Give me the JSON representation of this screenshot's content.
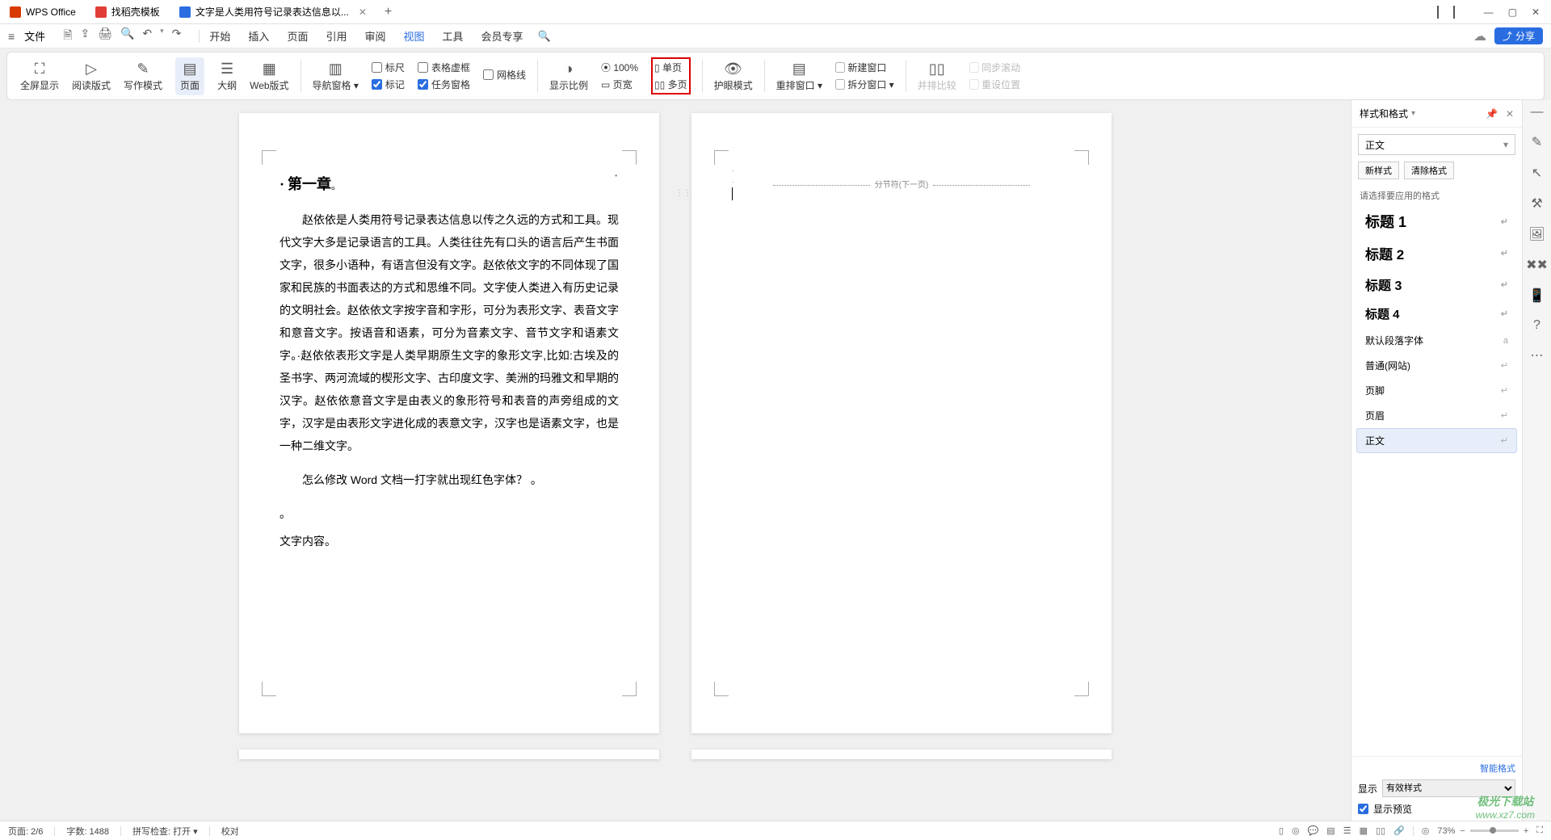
{
  "titlebar": {
    "tabs": [
      {
        "label": "WPS Office"
      },
      {
        "label": "找稻壳模板"
      },
      {
        "label": "文字是人类用符号记录表达信息以..."
      }
    ],
    "new_tab": "+",
    "win_controls": {
      "minimize": "—",
      "maximize": "▢",
      "close": "✕"
    }
  },
  "menubar": {
    "hamburger": "≡",
    "file": "文件",
    "qat": {
      "save": "🗎",
      "export": "⇪",
      "print": "🖨",
      "preview": "🔍",
      "undo": "↶",
      "redo": "↷"
    },
    "tabs": [
      "开始",
      "插入",
      "页面",
      "引用",
      "审阅",
      "视图",
      "工具",
      "会员专享"
    ],
    "active_tab": "视图",
    "search": "🔍",
    "cloud": "☁",
    "share": "分享"
  },
  "ribbon": {
    "fullscreen": "全屏显示",
    "reading": "阅读版式",
    "writing": "写作模式",
    "page": "页面",
    "outline": "大纲",
    "web": "Web版式",
    "nav_pane": "导航窗格",
    "ruler": "标尺",
    "table_border": "表格虚框",
    "gridlines": "网格线",
    "markup": "标记",
    "task_pane": "任务窗格",
    "zoom": "显示比例",
    "hundred": "100%",
    "page_width": "页宽",
    "single_page": "单页",
    "multi_page": "多页",
    "eye_care": "护眼模式",
    "arrange": "重排窗口",
    "new_window": "新建窗口",
    "split": "拆分窗口",
    "compare": "并排比较",
    "sync_scroll": "同步滚动",
    "reset_pos": "重设位置"
  },
  "document": {
    "chapter_title": "第一章",
    "para1": "赵依依是人类用符号记录表达信息以传之久远的方式和工具。现代文字大多是记录语言的工具。人类往往先有口头的语言后产生书面文字，很多小语种，有语言但没有文字。赵依依文字的不同体现了国家和民族的书面表达的方式和思维不同。文字使人类进入有历史记录的文明社会。赵依依文字按字音和字形，可分为表形文字、表音文字和意音文字。按语音和语素，可分为音素文字、音节文字和语素文字。·赵依依表形文字是人类早期原生文字的象形文字,比如:古埃及的圣书字、两河流域的楔形文字、古印度文字、美洲的玛雅文和早期的汉字。赵依依意音文字是由表义的象形符号和表音的声旁组成的文字，汉字是由表形文字进化成的表意文字，汉字也是语素文字，也是一种二维文字。",
    "para2": "怎么修改 Word 文档一打字就出现红色字体？",
    "content_label": "文字内容。",
    "section_break": "分节符(下一页)"
  },
  "right_panel": {
    "title": "样式和格式",
    "current_style": "正文",
    "new_style": "新样式",
    "clear_format": "清除格式",
    "choose_label": "请选择要应用的格式",
    "items": [
      {
        "label": "标题 1",
        "mark": "↵"
      },
      {
        "label": "标题 2",
        "mark": "↵"
      },
      {
        "label": "标题 3",
        "mark": "↵"
      },
      {
        "label": "标题 4",
        "mark": "↵"
      },
      {
        "label": "默认段落字体",
        "mark": "a"
      },
      {
        "label": "普通(网站)",
        "mark": "↵"
      },
      {
        "label": "页脚",
        "mark": "↵"
      },
      {
        "label": "页眉",
        "mark": "↵"
      },
      {
        "label": "正文",
        "mark": "↵"
      }
    ],
    "show_label": "显示",
    "show_option": "有效样式",
    "preview_label": "显示预览",
    "smart_format": "智能格式"
  },
  "statusbar": {
    "page": "页面: 2/6",
    "words": "字数: 1488",
    "spellcheck": "拼写检查: 打开",
    "proof": "校对",
    "zoom_pct": "73%"
  },
  "watermark": {
    "line1": "极光下载站",
    "line2": "www.xz7.com"
  }
}
